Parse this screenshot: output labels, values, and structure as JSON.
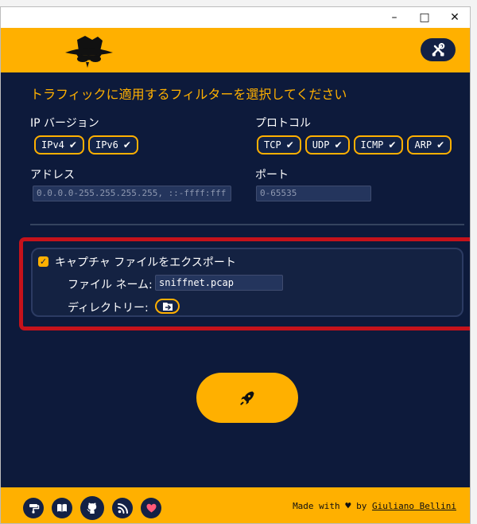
{
  "window": {
    "controls": {
      "minimize": "–",
      "maximize": "□",
      "close": "✕"
    }
  },
  "colors": {
    "accent": "#ffb000",
    "background": "#0d1a3b",
    "panel": "#142242",
    "highlight": "#c5121b"
  },
  "header": {
    "logo_icon": "spy-hat-icon",
    "settings_icon": "wrench-screwdriver-icon"
  },
  "filters": {
    "title": "トラフィックに適用するフィルターを選択してください",
    "ip_version": {
      "label": "IP バージョン",
      "options": [
        {
          "label": "IPv4",
          "checked": true
        },
        {
          "label": "IPv6",
          "checked": true
        }
      ]
    },
    "protocol": {
      "label": "プロトコル",
      "options": [
        {
          "label": "TCP",
          "checked": true
        },
        {
          "label": "UDP",
          "checked": true
        },
        {
          "label": "ICMP",
          "checked": true
        },
        {
          "label": "ARP",
          "checked": true
        }
      ]
    },
    "address": {
      "label": "アドレス",
      "placeholder": "0.0.0.0-255.255.255.255, ::-ffff:fff"
    },
    "port": {
      "label": "ポート",
      "placeholder": "0-65535"
    }
  },
  "export": {
    "checked": true,
    "label": "キャプチャ ファイルをエクスポート",
    "file_name_label": "ファイル ネーム:",
    "file_name_value": "sniffnet.pcap",
    "directory_label": "ディレクトリー:",
    "directory_icon": "folder-export-icon"
  },
  "actions": {
    "start_icon": "rocket-icon"
  },
  "footer": {
    "icons": [
      "paint-roller-icon",
      "book-icon",
      "github-icon",
      "rss-icon",
      "heart-icon"
    ],
    "made_with": "Made with",
    "heart": "♥",
    "by": "by",
    "author": "Giuliano Bellini"
  }
}
